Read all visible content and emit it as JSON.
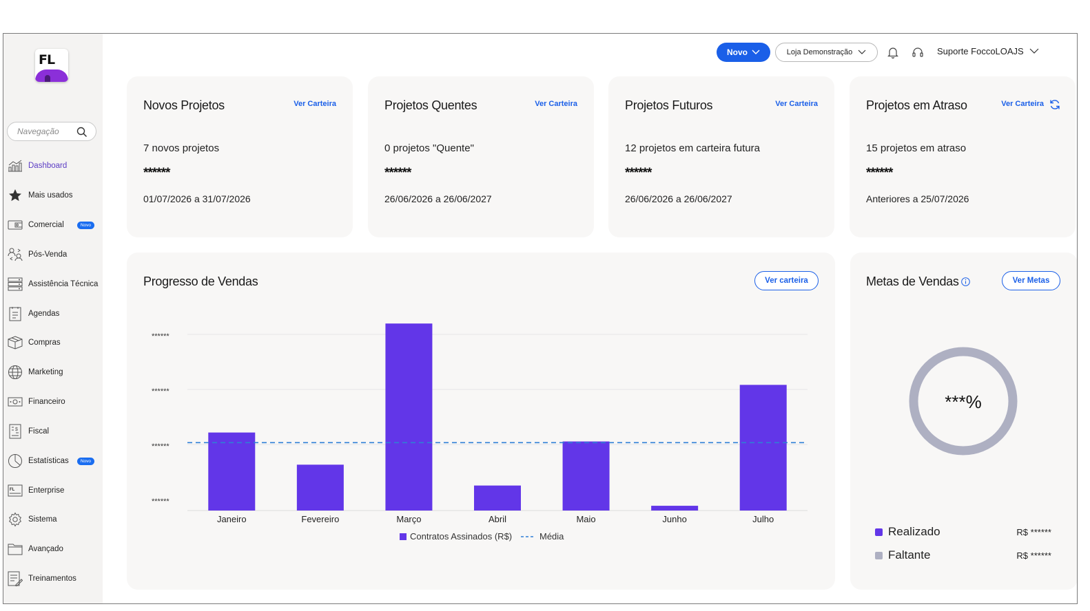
{
  "sidebar": {
    "logo_text": "FL",
    "search_placeholder": "Navegação",
    "items": [
      {
        "label": "Dashboard",
        "icon": "chart-icon"
      },
      {
        "label": "Mais usados",
        "icon": "star-icon"
      },
      {
        "label": "Comercial",
        "icon": "wallet-icon",
        "badge": "Novo"
      },
      {
        "label": "Pós-Venda",
        "icon": "handshake-icon"
      },
      {
        "label": "Assistência Técnica",
        "icon": "server-icon"
      },
      {
        "label": "Agendas",
        "icon": "calendar-icon"
      },
      {
        "label": "Compras",
        "icon": "box-icon"
      },
      {
        "label": "Marketing",
        "icon": "globe-icon"
      },
      {
        "label": "Financeiro",
        "icon": "money-icon"
      },
      {
        "label": "Fiscal",
        "icon": "receipt-icon"
      },
      {
        "label": "Estatísticas",
        "icon": "pie-icon",
        "badge": "Novo"
      },
      {
        "label": "Enterprise",
        "icon": "enterprise-icon"
      },
      {
        "label": "Sistema",
        "icon": "gear-icon"
      },
      {
        "label": "Avançado",
        "icon": "folder-icon"
      },
      {
        "label": "Treinamentos",
        "icon": "training-icon"
      }
    ]
  },
  "header": {
    "novo_label": "Novo",
    "store_label": "Loja Demonstração",
    "user_label": "Suporte FoccoLOAJS"
  },
  "stats": [
    {
      "title": "Novos Projetos",
      "link": "Ver Carteira",
      "desc": "7 novos projetos",
      "mask": "******",
      "range": "01/07/2026 a 31/07/2026"
    },
    {
      "title": "Projetos Quentes",
      "link": "Ver Carteira",
      "desc": "0 projetos \"Quente\"",
      "mask": "******",
      "range": "26/06/2026 a 26/06/2027"
    },
    {
      "title": "Projetos Futuros",
      "link": "Ver Carteira",
      "desc": "12 projetos em carteira futura",
      "mask": "******",
      "range": "26/06/2026 a 26/06/2027"
    },
    {
      "title": "Projetos em Atraso",
      "link": "Ver Carteira",
      "desc": "15 projetos em atraso",
      "mask": "******",
      "range": "Anteriores a 25/07/2026"
    }
  ],
  "sales_progress": {
    "title": "Progresso de Vendas",
    "button": "Ver carteira"
  },
  "chart_data": {
    "type": "bar",
    "title": "Progresso de Vendas",
    "categories": [
      "Janeiro",
      "Fevereiro",
      "Março",
      "Abril",
      "Maio",
      "Junho",
      "Julho"
    ],
    "series": [
      {
        "name": "Contratos Assinados (R$)",
        "values": [
          1.31,
          0.77,
          3.14,
          0.42,
          1.16,
          0.08,
          2.11
        ]
      }
    ],
    "average": {
      "name": "Média",
      "value": 1.14
    },
    "y_tick_labels": [
      "******",
      "******",
      "******",
      "******"
    ],
    "ylim": [
      0,
      3.2
    ],
    "bar_color": "#6236e8",
    "average_color": "#2f7fd6",
    "legend": "bottom",
    "grid": true
  },
  "goals": {
    "title": "Metas de Vendas",
    "button": "Ver Metas",
    "donut_label": "***%",
    "realized_label": "Realizado",
    "realized_value": "R$ ******",
    "missing_label": "Faltante",
    "missing_value": "R$ ******",
    "realized_color": "#6236e8",
    "missing_color": "#aeb0c2"
  }
}
